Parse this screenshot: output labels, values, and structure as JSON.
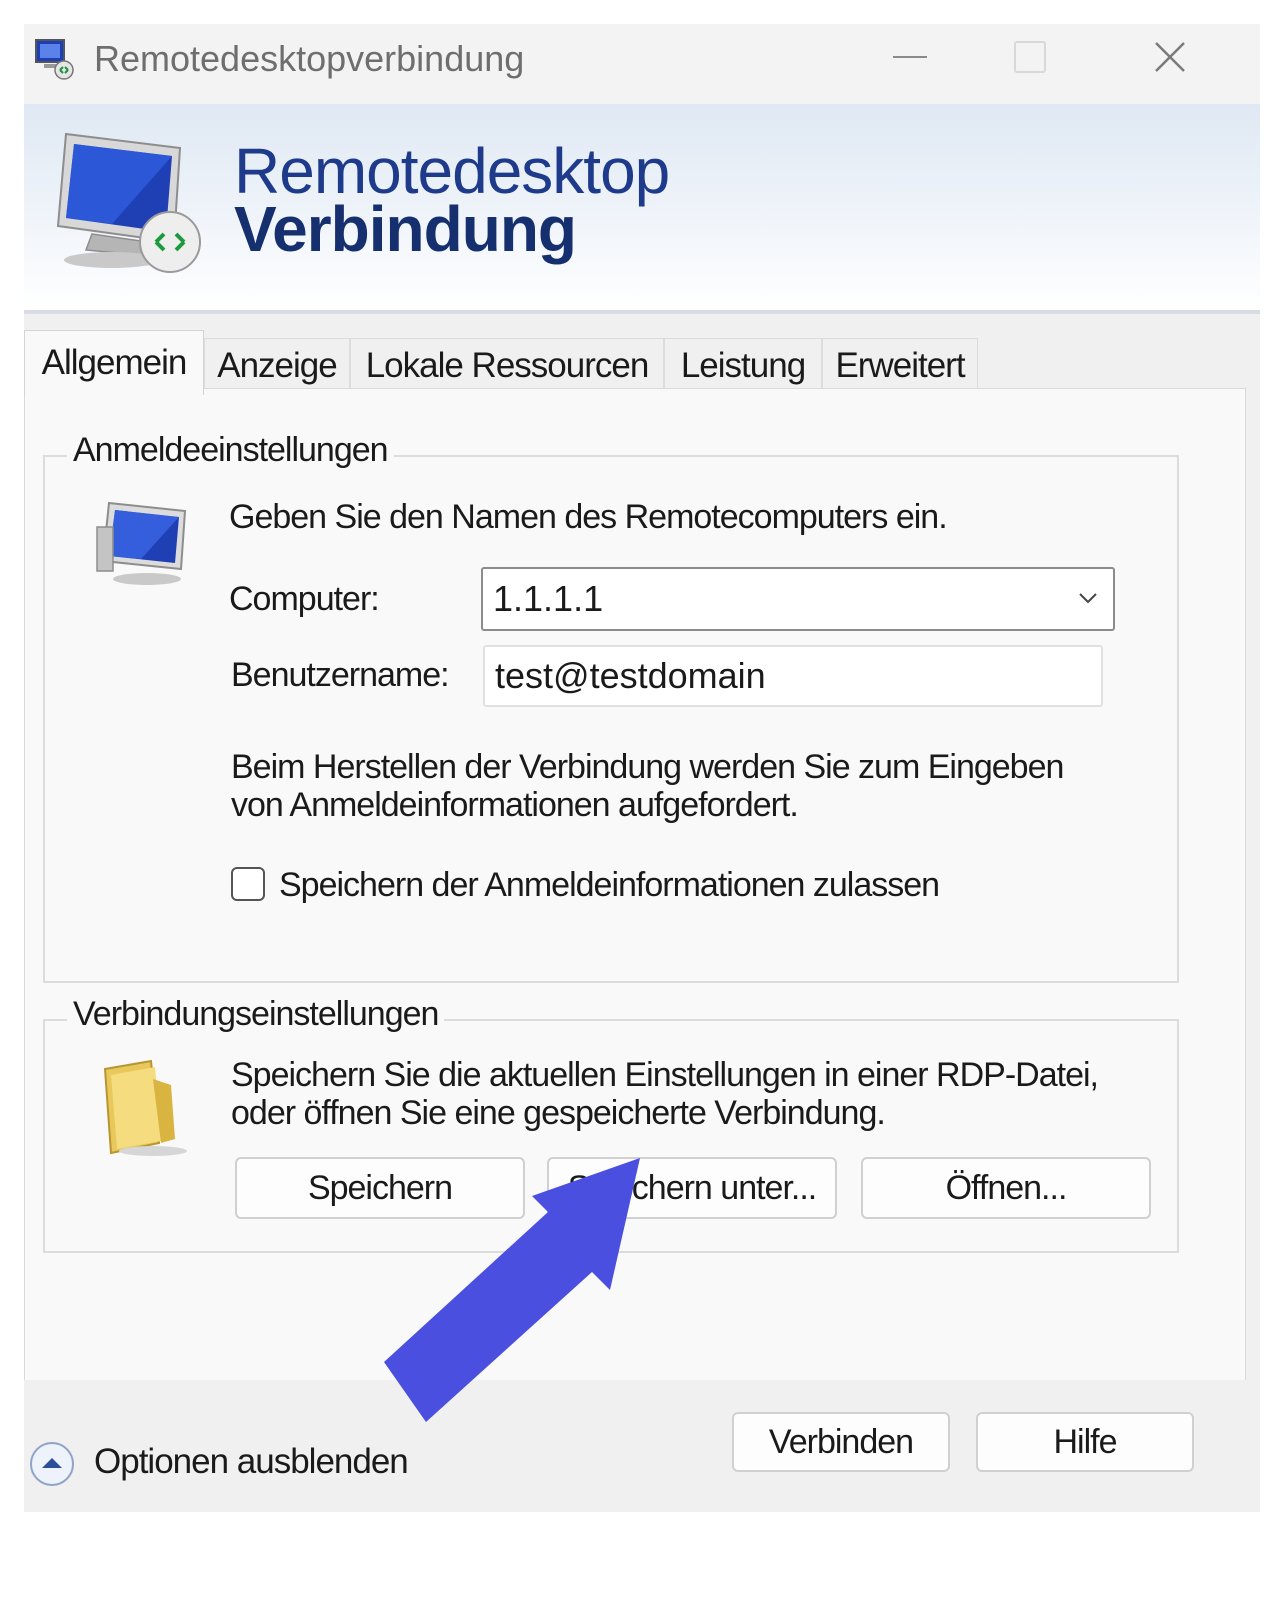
{
  "window": {
    "title": "Remotedesktopverbindung"
  },
  "banner": {
    "line1": "Remotedesktop",
    "line2": "Verbindung"
  },
  "tabs": [
    {
      "label": "Allgemein",
      "active": true
    },
    {
      "label": "Anzeige",
      "active": false
    },
    {
      "label": "Lokale Ressourcen",
      "active": false
    },
    {
      "label": "Leistung",
      "active": false
    },
    {
      "label": "Erweitert",
      "active": false
    }
  ],
  "login_group": {
    "legend": "Anmeldeeinstellungen",
    "intro": "Geben Sie den Namen des Remotecomputers ein.",
    "computer_label": "Computer:",
    "computer_value": "1.1.1.1",
    "username_label": "Benutzername:",
    "username_value": "test@testdomain",
    "info_line1": "Beim Herstellen der Verbindung werden Sie zum Eingeben",
    "info_line2": "von Anmeldeinformationen aufgefordert.",
    "save_credentials_label": "Speichern der Anmeldeinformationen zulassen",
    "save_credentials_checked": false
  },
  "connection_group": {
    "legend": "Verbindungseinstellungen",
    "desc_line1": "Speichern Sie die aktuellen Einstellungen in einer RDP-Datei,",
    "desc_line2": "oder öffnen Sie eine gespeicherte Verbindung.",
    "save_button": "Speichern",
    "save_as_button": "Speichern unter...",
    "open_button": "Öffnen..."
  },
  "footer": {
    "hide_options": "Optionen ausblenden",
    "connect_button": "Verbinden",
    "help_button": "Hilfe"
  },
  "colors": {
    "banner_text": "#1e3a8a",
    "annotation_arrow": "#4a4fe0"
  }
}
